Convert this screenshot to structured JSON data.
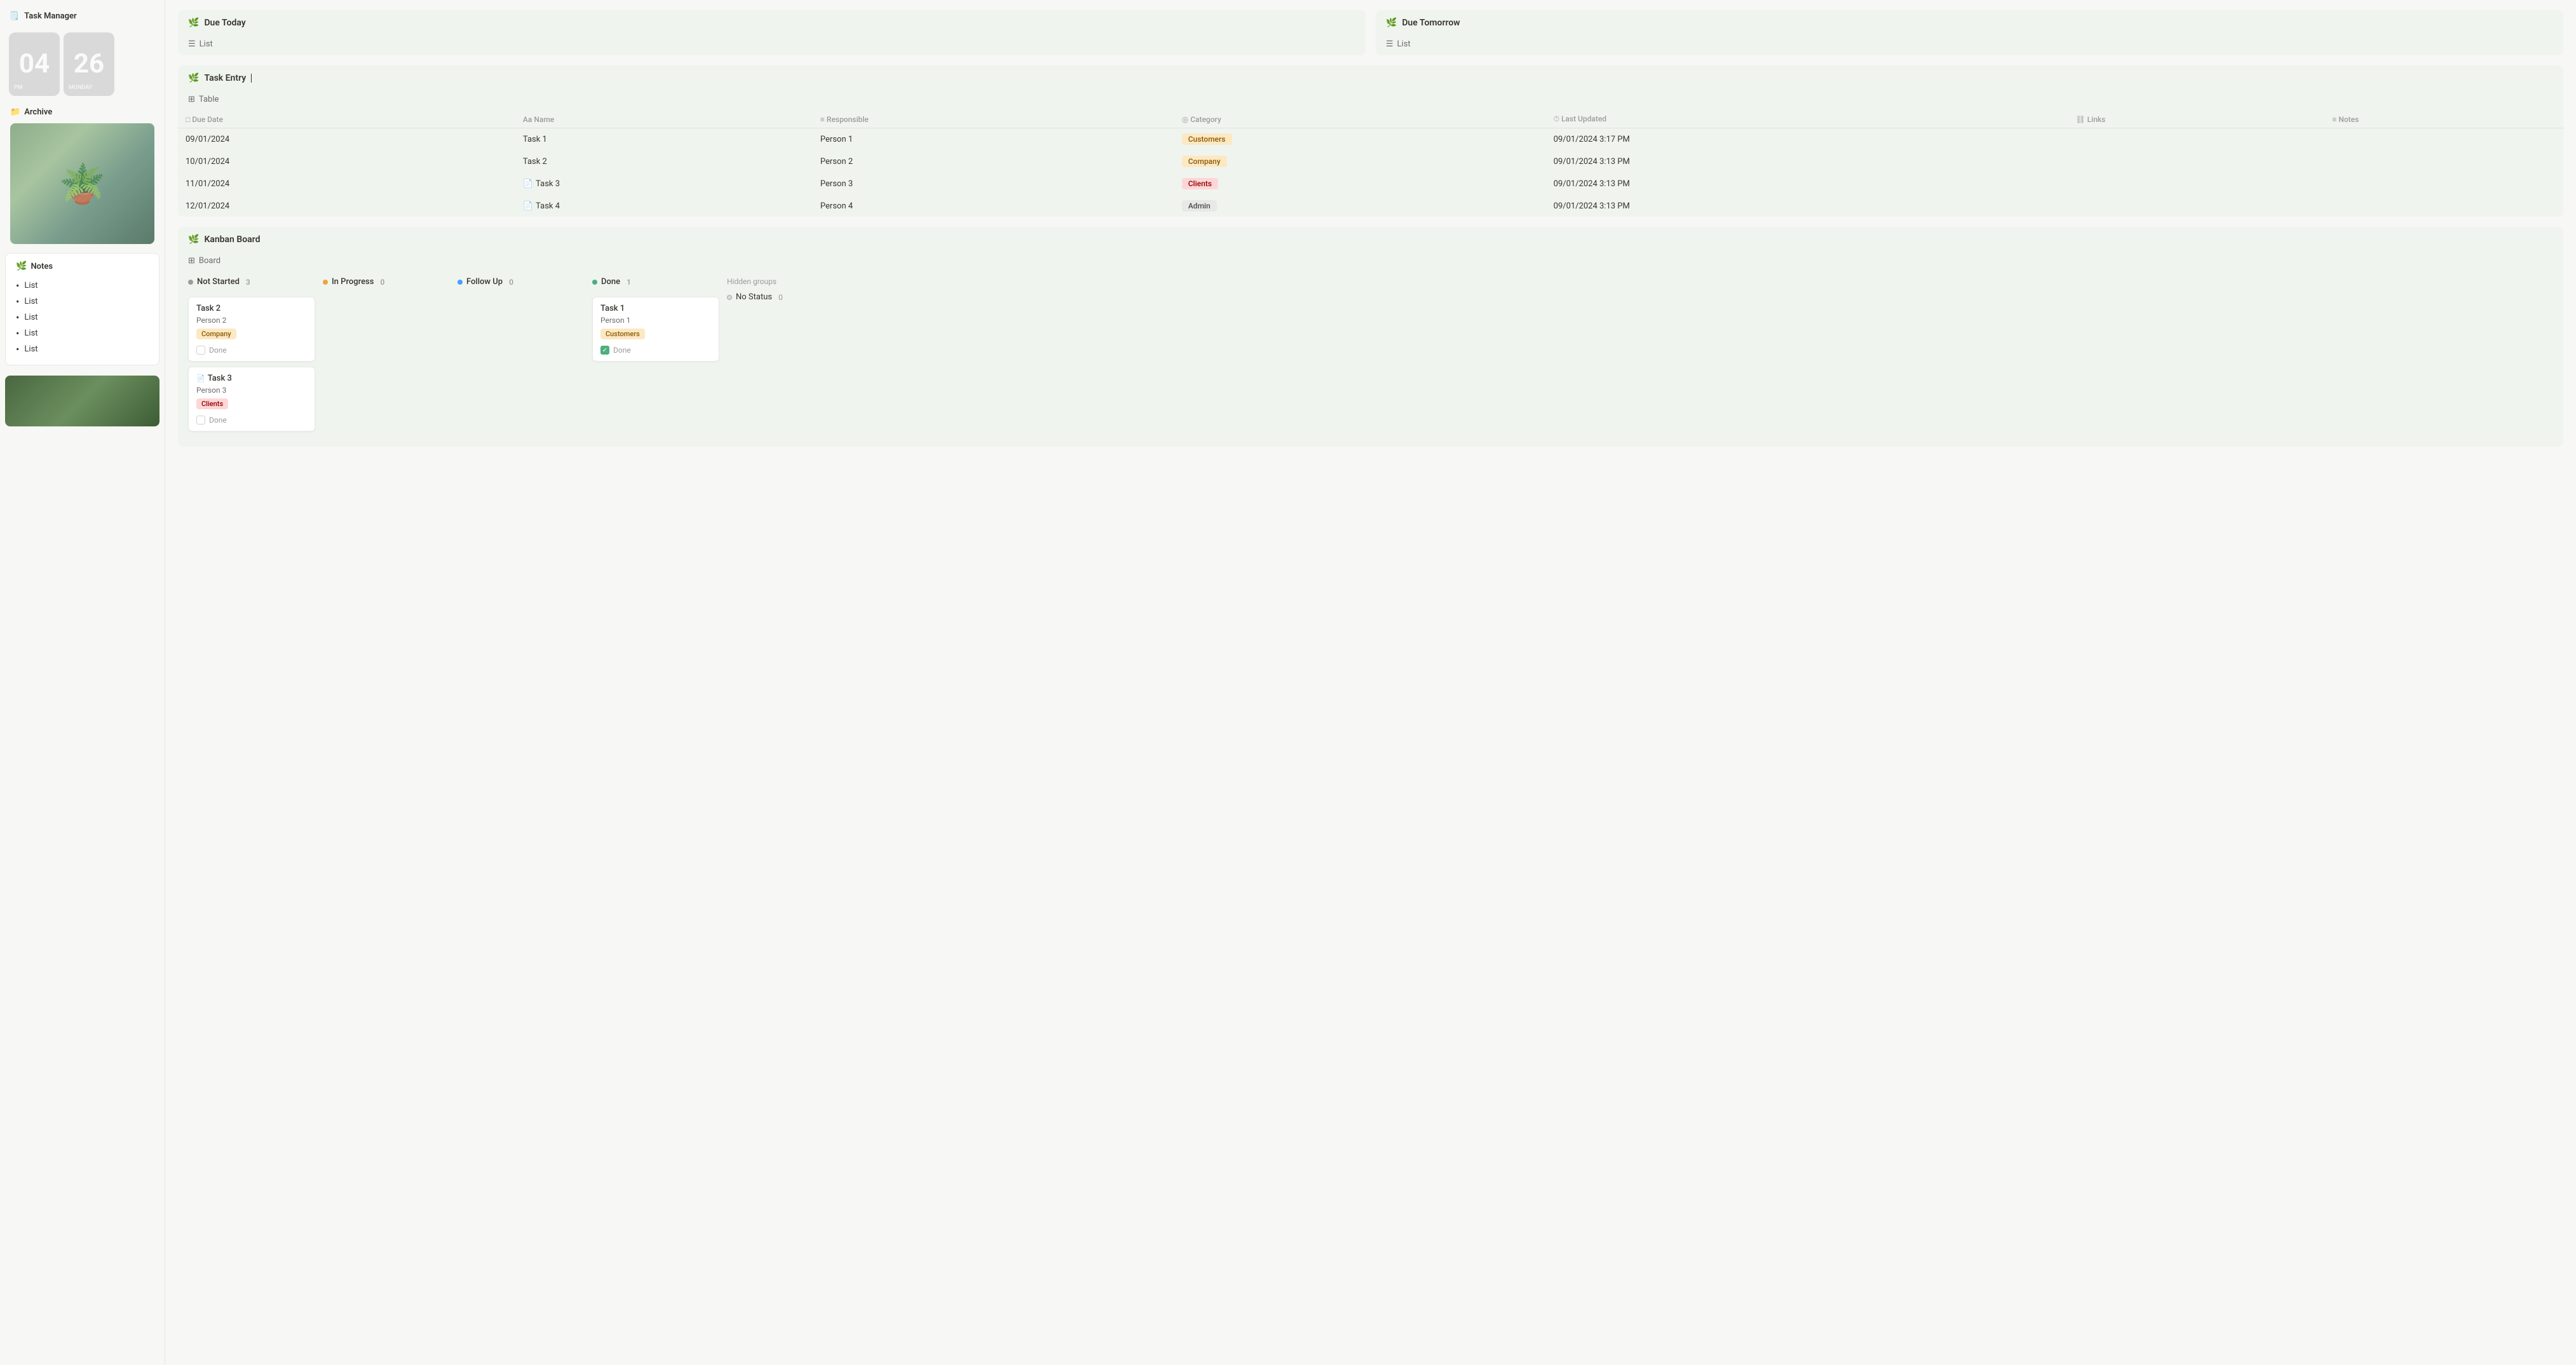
{
  "app": {
    "title": "Task Manager",
    "title_icon": "🗒️"
  },
  "clock": {
    "hour": "04",
    "minute": "26",
    "period": "PM",
    "day": "MONDAY"
  },
  "sidebar": {
    "archive_label": "Archive",
    "notes_label": "Notes",
    "notes_items": [
      "List",
      "List",
      "List",
      "List",
      "List"
    ]
  },
  "due_today": {
    "title": "Due Today",
    "view_label": "List"
  },
  "due_tomorrow": {
    "title": "Due Tomorrow",
    "view_label": "List"
  },
  "task_entry": {
    "title": "Task Entry",
    "view_label": "Table",
    "columns": [
      "Due Date",
      "Name",
      "Responsible",
      "Category",
      "Last Updated",
      "Links",
      "Notes"
    ],
    "rows": [
      {
        "due_date": "09/01/2024",
        "name": "Task 1",
        "responsible": "Person 1",
        "category": "Customers",
        "last_updated": "09/01/2024 3:17 PM",
        "links": "",
        "notes": "",
        "badge_class": "badge-customers",
        "has_doc_icon": false
      },
      {
        "due_date": "10/01/2024",
        "name": "Task 2",
        "responsible": "Person 2",
        "category": "Company",
        "last_updated": "09/01/2024 3:13 PM",
        "links": "",
        "notes": "",
        "badge_class": "badge-company",
        "has_doc_icon": false
      },
      {
        "due_date": "11/01/2024",
        "name": "Task 3",
        "responsible": "Person 3",
        "category": "Clients",
        "last_updated": "09/01/2024 3:13 PM",
        "links": "",
        "notes": "",
        "badge_class": "badge-clients",
        "has_doc_icon": true
      },
      {
        "due_date": "12/01/2024",
        "name": "Task 4",
        "responsible": "Person 4",
        "category": "Admin",
        "last_updated": "09/01/2024 3:13 PM",
        "links": "",
        "notes": "",
        "badge_class": "badge-admin",
        "has_doc_icon": true
      }
    ]
  },
  "kanban": {
    "title": "Kanban Board",
    "view_label": "Board",
    "columns": [
      {
        "id": "not-started",
        "label": "Not Started",
        "count": 3,
        "dot_class": "dot-not-started",
        "cards": [
          {
            "title": "Task 2",
            "person": "Person 2",
            "badge": "Company",
            "badge_class": "badge-company",
            "done_checked": false,
            "done_label": "Done",
            "has_doc": false
          },
          {
            "title": "Task 3",
            "person": "Person 3",
            "badge": "Clients",
            "badge_class": "badge-clients",
            "done_checked": false,
            "done_label": "Done",
            "has_doc": true
          }
        ]
      },
      {
        "id": "in-progress",
        "label": "In Progress",
        "count": 0,
        "dot_class": "dot-in-progress",
        "cards": []
      },
      {
        "id": "follow-up",
        "label": "Follow Up",
        "count": 0,
        "dot_class": "dot-follow-up",
        "cards": []
      },
      {
        "id": "done",
        "label": "Done",
        "count": 1,
        "dot_class": "dot-done",
        "cards": [
          {
            "title": "Task 1",
            "person": "Person 1",
            "badge": "Customers",
            "badge_class": "badge-customers",
            "done_checked": true,
            "done_label": "Done",
            "has_doc": false
          }
        ]
      }
    ],
    "hidden_groups_label": "Hidden groups",
    "no_status_label": "No Status",
    "no_status_count": 0
  },
  "extra_cards": {
    "task2_person2": {
      "title": "Task 2",
      "person": "Person 2",
      "badge": "Company",
      "done_label": "Done"
    },
    "task_person3": {
      "title": "Task",
      "person": "Person 3",
      "badge": "Clients",
      "done_label": "Done"
    },
    "task_person_customers": {
      "title": "Task",
      "person": "Person",
      "badge": "Customers",
      "done_label": "Done"
    }
  }
}
